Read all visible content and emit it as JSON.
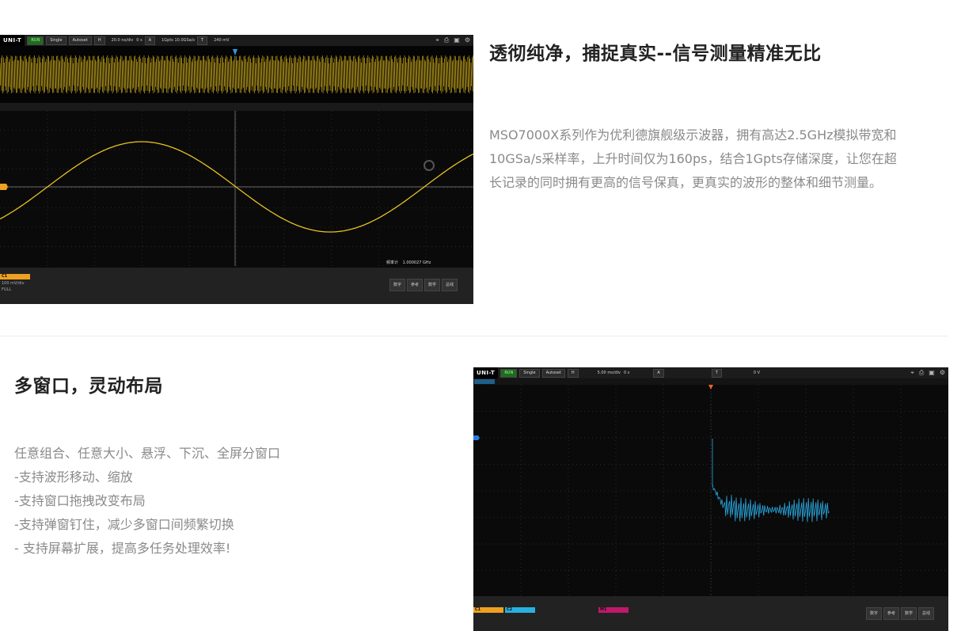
{
  "section1": {
    "heading": "透彻纯净，捕捉真实--信号测量精准无比",
    "paragraph_lines": [
      "MSO7000X系列作为优利德旗舰级示波器，拥有高达2.5GHz模拟带宽和",
      "10GSa/s采样率，上升时间仅为160ps，结合1Gpts存储深度，让您在超",
      "长记录的同时拥有更高的信号保真，更真实的波形的整体和细节测量。"
    ],
    "scope": {
      "logo": "UNI-T",
      "run_label": "RUN",
      "single_label": "Single",
      "autoset_label": "Autoset",
      "h_label": "H",
      "timebase": "20.0 ns/div",
      "offset": "0 s",
      "acq_label": "A",
      "sample_rate": "1Gpts  10.0GSa/s",
      "trig_label": "T",
      "trig_level": "240 mV",
      "ch1_scale": "100 mV/div",
      "ch1_coupling": "FULL",
      "measure_label": "频率计",
      "measure_value": "1.000027 GHz",
      "colors": {
        "waveform": "#e8c21e",
        "channel1": "#f0a020",
        "background": "#0a0a0a"
      }
    }
  },
  "section2": {
    "heading": "多窗口，灵动布局",
    "paragraph_lines": [
      "任意组合、任意大小、悬浮、下沉、全屏分窗口",
      "-支持波形移动、缩放",
      "-支持窗口拖拽改变布局",
      "-支持弹窗钉住，减少多窗口间频繁切换",
      "- 支持屏幕扩展，提高多任务处理效率!"
    ],
    "scope": {
      "logo": "UNI-T",
      "run_label": "RUN",
      "single_label": "Single",
      "autoset_label": "Autoset",
      "h_label": "H",
      "timebase": "5.00 ms/div",
      "offset": "0 s",
      "acq_label": "A",
      "trig_label": "T",
      "trig_level": "0 V",
      "colors": {
        "spectrum": "#2aa8e0",
        "channel1": "#f0a020",
        "background": "#0a0a0a"
      }
    }
  }
}
